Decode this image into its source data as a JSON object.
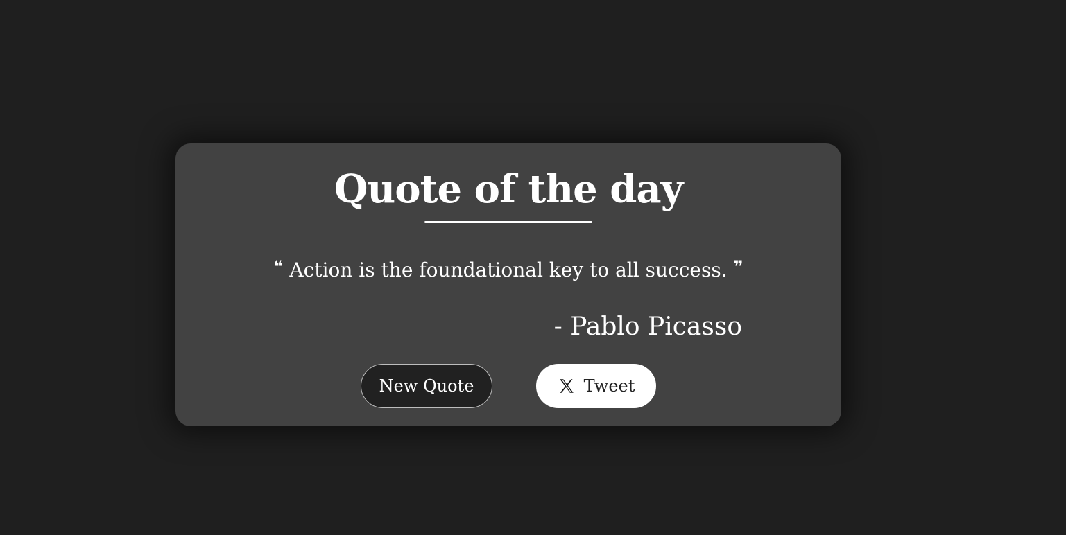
{
  "card": {
    "title": "Quote of the day",
    "quote": {
      "open_mark": "❝",
      "text": "Action is the foundational key to all success.",
      "close_mark": "❞"
    },
    "author": "- Pablo Picasso",
    "buttons": {
      "new_quote_label": "New Quote",
      "tweet_label": "Tweet",
      "tweet_icon": "x-logo-icon"
    }
  },
  "colors": {
    "page_background": "#1f1f1f",
    "card_background": "#424242",
    "text": "#ffffff",
    "new_quote_button_bg": "#212121",
    "tweet_button_bg": "#ffffff"
  }
}
